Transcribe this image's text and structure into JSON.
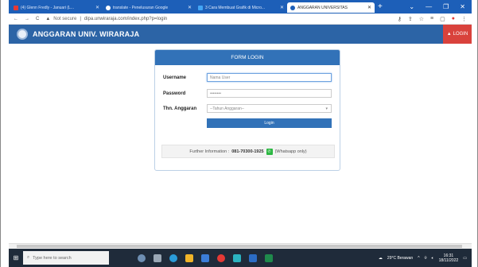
{
  "browser": {
    "tabs": [
      {
        "label": "(4) Glenn Fredly - Januari (L...",
        "fav_color": "#e53935"
      },
      {
        "label": "translate - Penelusuran Google",
        "fav_color": "#ffffff"
      },
      {
        "label": "3 Cara Membuat Grafik di Micro...",
        "fav_color": "#1e88e5"
      },
      {
        "label": "ANGGARAN UNIVERSITAS",
        "fav_color": "#1d5fb8"
      }
    ],
    "active_tab_index": 3,
    "new_tab": "+",
    "address": {
      "notsecure_label": "Not secure",
      "url": "dipa.unwiraraja.com/index.php?p=login"
    }
  },
  "app": {
    "name": "ANGGARAN UNIV. WIRARAJA",
    "login_button": "LOGIN",
    "accent": "#2c64a6",
    "login_color": "#d9423c"
  },
  "form": {
    "title": "FORM LOGIN",
    "username_label": "Username",
    "username_placeholder": "Nama User",
    "password_label": "Password",
    "password_value": "••••••••",
    "year_label": "Thn. Anggaran",
    "year_selected": "--Tahun Anggaran--",
    "submit": "Login",
    "info_text": "Further Information :",
    "info_phone": "081-70300-1925",
    "info_suffix": "(Whatsapp only)"
  },
  "taskbar": {
    "search_placeholder": "Type here to search",
    "weather": "29°C Berawan",
    "time": "16:31",
    "date": "18/11/2022"
  }
}
